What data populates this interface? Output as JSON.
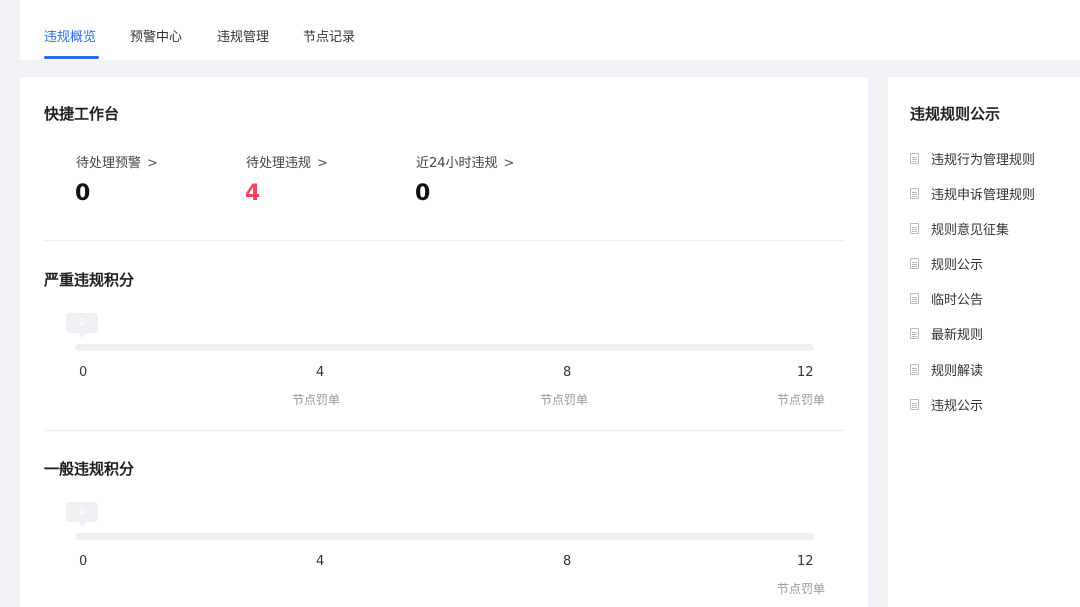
{
  "tabs": [
    {
      "label": "违规概览",
      "active": true
    },
    {
      "label": "预警中心",
      "active": false
    },
    {
      "label": "违规管理",
      "active": false
    },
    {
      "label": "节点记录",
      "active": false
    }
  ],
  "colors": {
    "accent": "#2b6cf5",
    "alert": "#f5455c"
  },
  "quick": {
    "title": "快捷工作台",
    "stats": [
      {
        "label": "待处理预警",
        "value": "0"
      },
      {
        "label": "待处理违规",
        "value": "4"
      },
      {
        "label": "近24小时违规",
        "value": "0"
      }
    ]
  },
  "severe": {
    "title": "严重违规积分",
    "score": "0",
    "score_fraction": 0,
    "ticks": [
      "0",
      "4",
      "8",
      "12"
    ],
    "tick_labels": [
      "",
      "节点罚单",
      "节点罚单",
      "节点罚单"
    ]
  },
  "general": {
    "title": "一般违规积分",
    "score": "0",
    "score_fraction": 0,
    "ticks": [
      "0",
      "4",
      "8",
      "12"
    ],
    "tick_labels": [
      "",
      "",
      "",
      "节点罚单"
    ]
  },
  "rules": {
    "title": "违规规则公示",
    "items": [
      "违规行为管理规则",
      "违规申诉管理规则",
      "规则意见征集",
      "规则公示",
      "临时公告",
      "最新规则",
      "规则解读",
      "违规公示"
    ]
  }
}
